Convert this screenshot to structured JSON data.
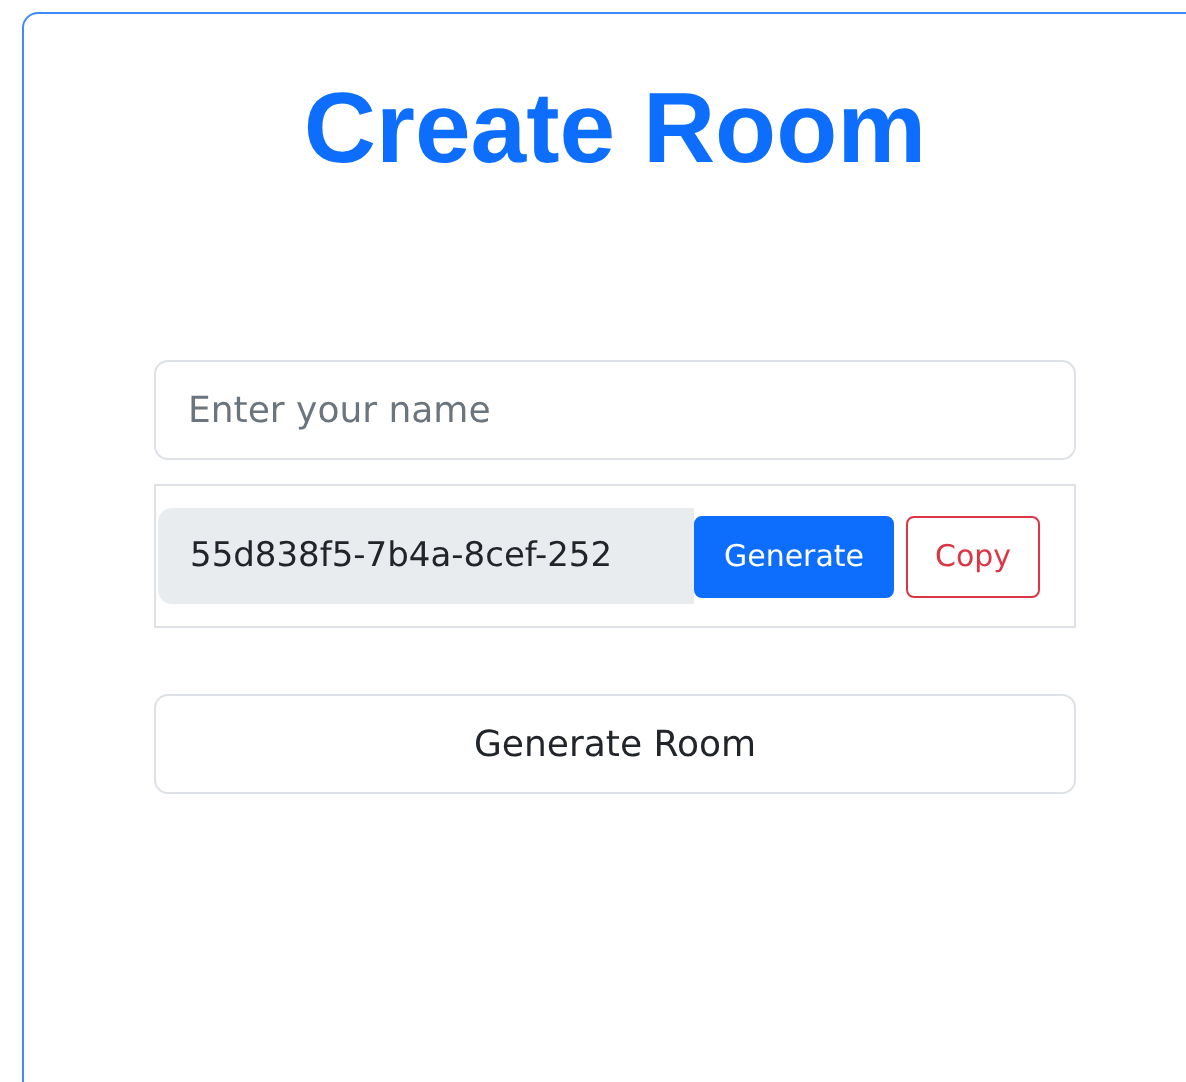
{
  "title": "Create Room",
  "name_field": {
    "placeholder": "Enter your name"
  },
  "room_id": {
    "value": "55d838f5-7b4a-8cef-252"
  },
  "id_buttons": [
    {
      "label": "Generate",
      "kind": "primary"
    },
    {
      "label": "Copy",
      "kind": "outline-danger"
    }
  ],
  "submit": {
    "label": "Generate Room"
  }
}
